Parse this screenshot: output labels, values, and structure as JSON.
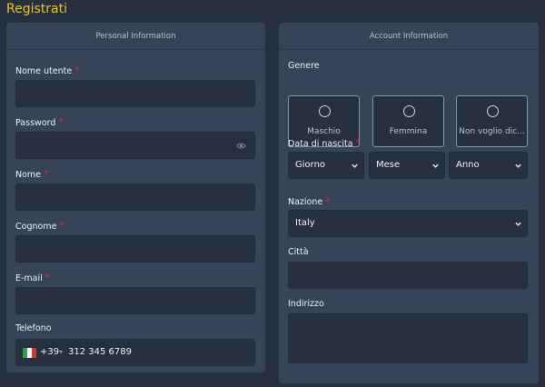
{
  "page": {
    "title": "Registrati"
  },
  "personal": {
    "header": "Personal Information",
    "username": {
      "label": "Nome utente",
      "required": "*",
      "value": ""
    },
    "password": {
      "label": "Password",
      "required": "*",
      "value": ""
    },
    "first_name": {
      "label": "Nome",
      "required": "*",
      "value": ""
    },
    "last_name": {
      "label": "Cognome",
      "required": "*",
      "value": ""
    },
    "email": {
      "label": "E-mail",
      "required": "*",
      "value": ""
    },
    "phone": {
      "label": "Telefono",
      "country_code": "+39",
      "placeholder": "312 345 6789",
      "flag": "italy-flag-icon"
    }
  },
  "account": {
    "header": "Account Information",
    "gender": {
      "label": "Genere",
      "options": [
        "Maschio",
        "Femmina",
        "Non voglio dic..."
      ]
    },
    "birthdate": {
      "label": "Data di nascita",
      "required": "*",
      "day": "Giorno",
      "month": "Mese",
      "year": "Anno"
    },
    "country": {
      "label": "Nazione",
      "required": "*",
      "value": "Italy"
    },
    "city": {
      "label": "Città",
      "value": ""
    },
    "address": {
      "label": "Indirizzo",
      "value": ""
    }
  },
  "colors": {
    "background": "#27303f",
    "panel": "#364458",
    "title": "#f2c21a",
    "required": "#e0273a"
  }
}
